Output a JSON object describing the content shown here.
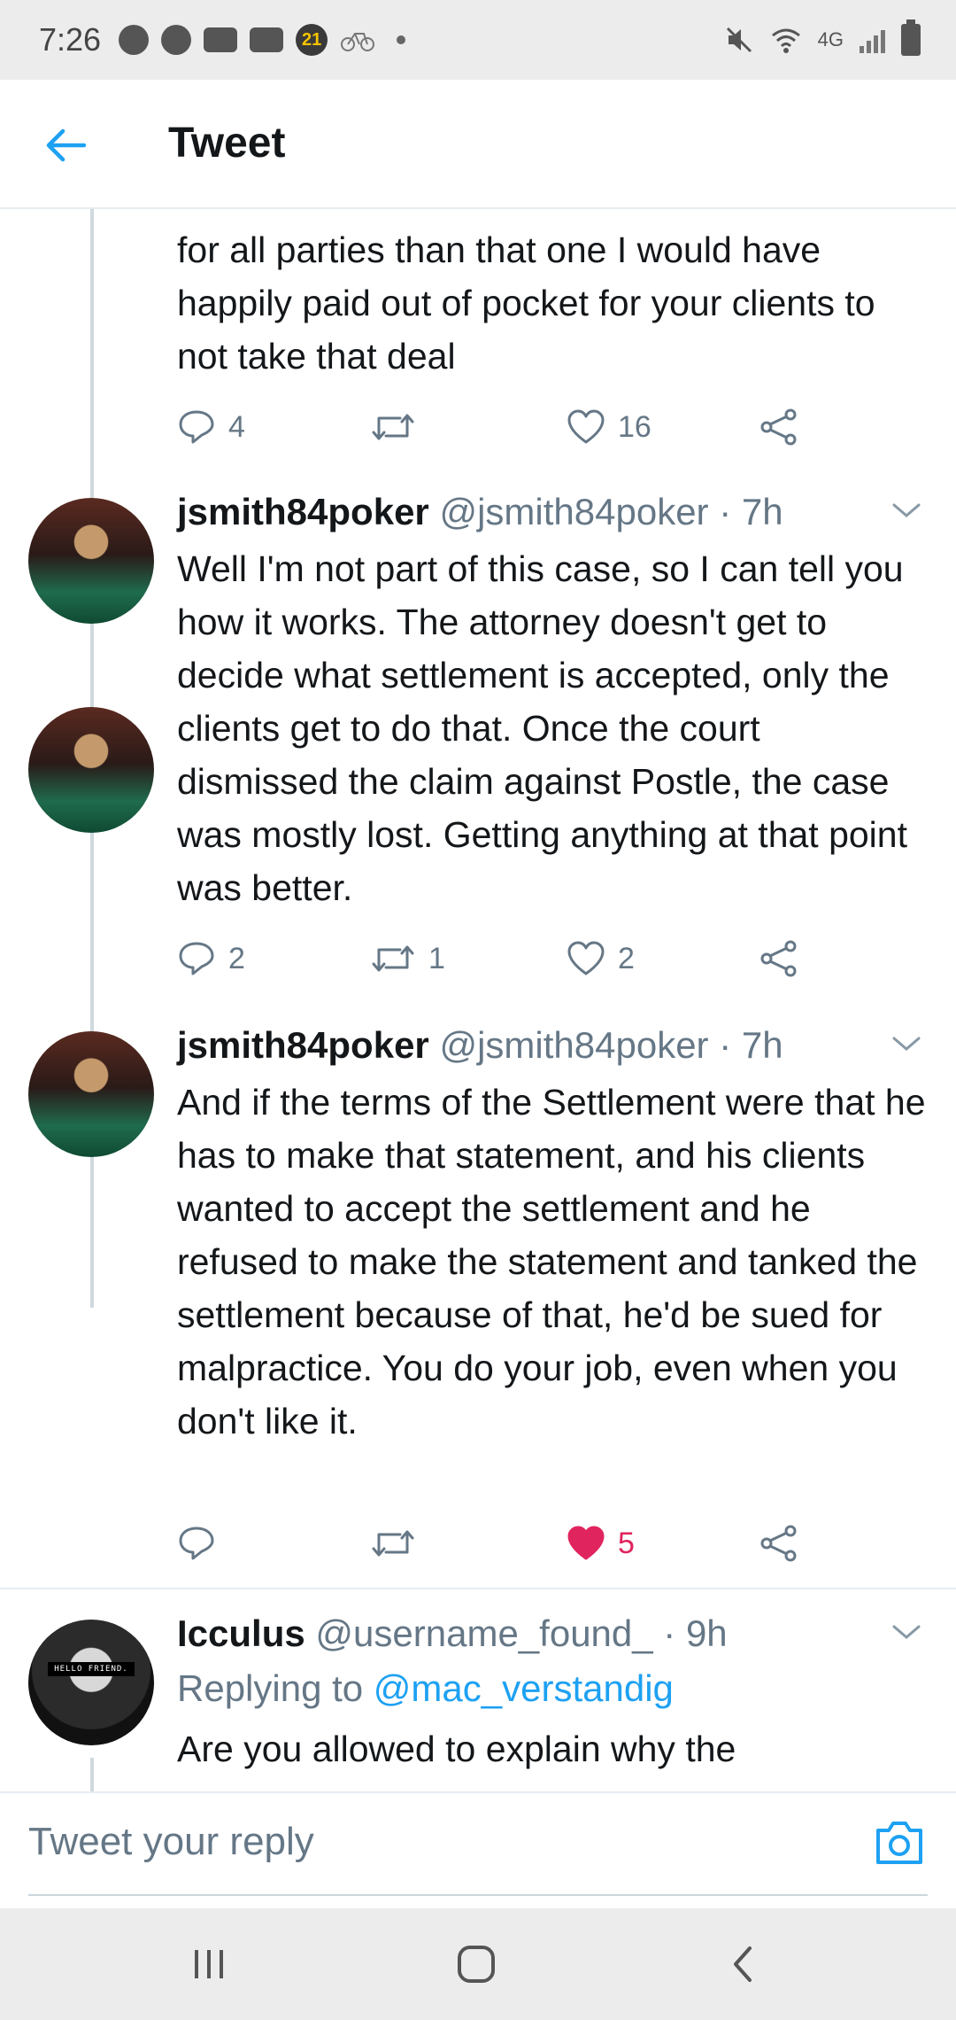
{
  "status_bar": {
    "time": "7:26",
    "network": "4G",
    "badge_21": "21"
  },
  "header": {
    "title": "Tweet"
  },
  "tweets": [
    {
      "text": "for all parties than that one I would have happily paid out of pocket for your clients to not take that deal",
      "replies": "4",
      "retweets": "",
      "likes": "16"
    },
    {
      "name": "jsmith84poker",
      "handle": "@jsmith84poker · 7h",
      "text": "Well I'm not part of this case, so I can tell you how it works. The attorney doesn't get to decide what settlement is accepted, only the clients get to do that. Once the court dismissed the claim against Postle, the case was mostly lost. Getting anything at that point was better.",
      "replies": "2",
      "retweets": "1",
      "likes": "2"
    },
    {
      "name": "jsmith84poker",
      "handle": "@jsmith84poker · 7h",
      "text": "And if the terms of the Settlement were that he has to make that statement, and his clients wanted to accept the settlement and he refused to make the statement and tanked the settlement because of that, he'd be sued for malpractice. You do your job, even when you don't like it.",
      "replies": "",
      "retweets": "",
      "likes": "5",
      "liked": true
    },
    {
      "name": "Icculus",
      "handle": "@username_found_ · 9h",
      "replying_prefix": "Replying to ",
      "replying_to": "@mac_verstandig",
      "text": "Are you allowed to explain why the",
      "avatar_text": "HELLO FRIEND."
    }
  ],
  "reply_bar": {
    "placeholder": "Tweet your reply"
  },
  "colors": {
    "accent": "#1da1f2",
    "like": "#e0245e",
    "secondary_text": "#657786"
  }
}
